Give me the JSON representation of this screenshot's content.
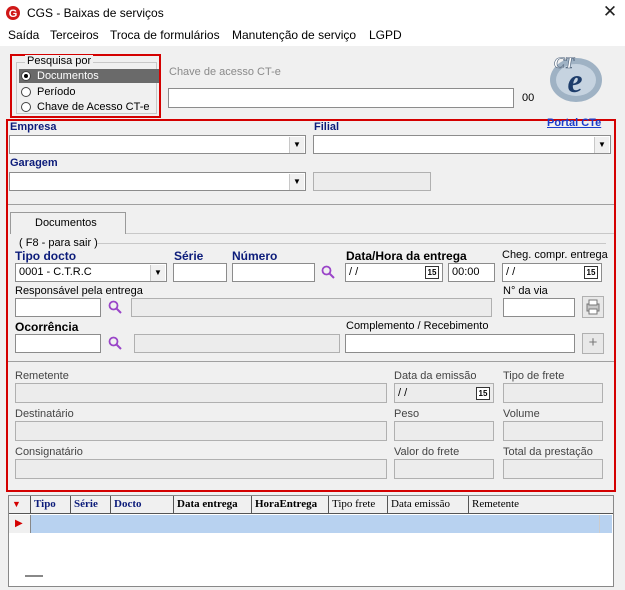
{
  "window": {
    "title": "CGS - Baixas de serviços",
    "close_glyph": "✕"
  },
  "menu": [
    "Saída",
    "Terceiros",
    "Troca de formulários",
    "Manutenção de serviço",
    "LGPD"
  ],
  "search": {
    "group_label": "Pesquisa por",
    "options": [
      "Documentos",
      "Período",
      "Chave de Acesso CT-e"
    ],
    "selected": "Documentos",
    "key_label": "Chave de acesso CT-e",
    "key_value": "",
    "key_suffix": "00"
  },
  "logo": {
    "text": "CT-e",
    "icon": "cte-logo-icon"
  },
  "portal_link": "Portal CTe",
  "empresa": {
    "label": "Empresa",
    "value": ""
  },
  "filial": {
    "label": "Filial",
    "value": ""
  },
  "garagem": {
    "label": "Garagem",
    "value": ""
  },
  "tab": {
    "label": "Documentos"
  },
  "hint": "( F8 - para sair )",
  "doc": {
    "tipo_label": "Tipo docto",
    "tipo_value": "0001 - C.T.R.C",
    "serie_label": "Série",
    "numero_label": "Número",
    "data_hora_label": "Data/Hora da entrega",
    "date_value": " /  /",
    "time_value": "00:00",
    "cheg_label": "Cheg. compr. entrega",
    "cheg_value": " /  /",
    "resp_label": "Responsável pela entrega",
    "via_label": "N° da via",
    "ocorrencia_label": "Ocorrência",
    "complemento_label": "Complemento / Recebimento"
  },
  "info": {
    "remetente": "Remetente",
    "data_emissao": "Data da emissão",
    "data_emissao_value": " /  /",
    "tipo_frete": "Tipo de frete",
    "destinatario": "Destinatário",
    "peso": "Peso",
    "volume": "Volume",
    "consignatario": "Consignatário",
    "valor_frete": "Valor do frete",
    "total_prestacao": "Total da prestação"
  },
  "grid": {
    "columns": [
      {
        "label": "Tipo",
        "navy": true
      },
      {
        "label": "Série",
        "navy": true
      },
      {
        "label": "Docto",
        "navy": true
      },
      {
        "label": "Data entrega",
        "navy": false
      },
      {
        "label": "HoraEntrega",
        "navy": false
      },
      {
        "label": "Tipo frete",
        "navy": false,
        "normal": true
      },
      {
        "label": "Data emissão",
        "navy": false,
        "normal": true
      },
      {
        "label": "Remetente",
        "navy": false,
        "normal": true
      }
    ],
    "sort_indicator": "▼",
    "row_indicator": "▶"
  },
  "colors": {
    "highlight_red": "#d40000",
    "selection_blue": "#b8d2f0",
    "link_blue": "#1a3ccc",
    "label_navy": "#0c1c7a"
  }
}
